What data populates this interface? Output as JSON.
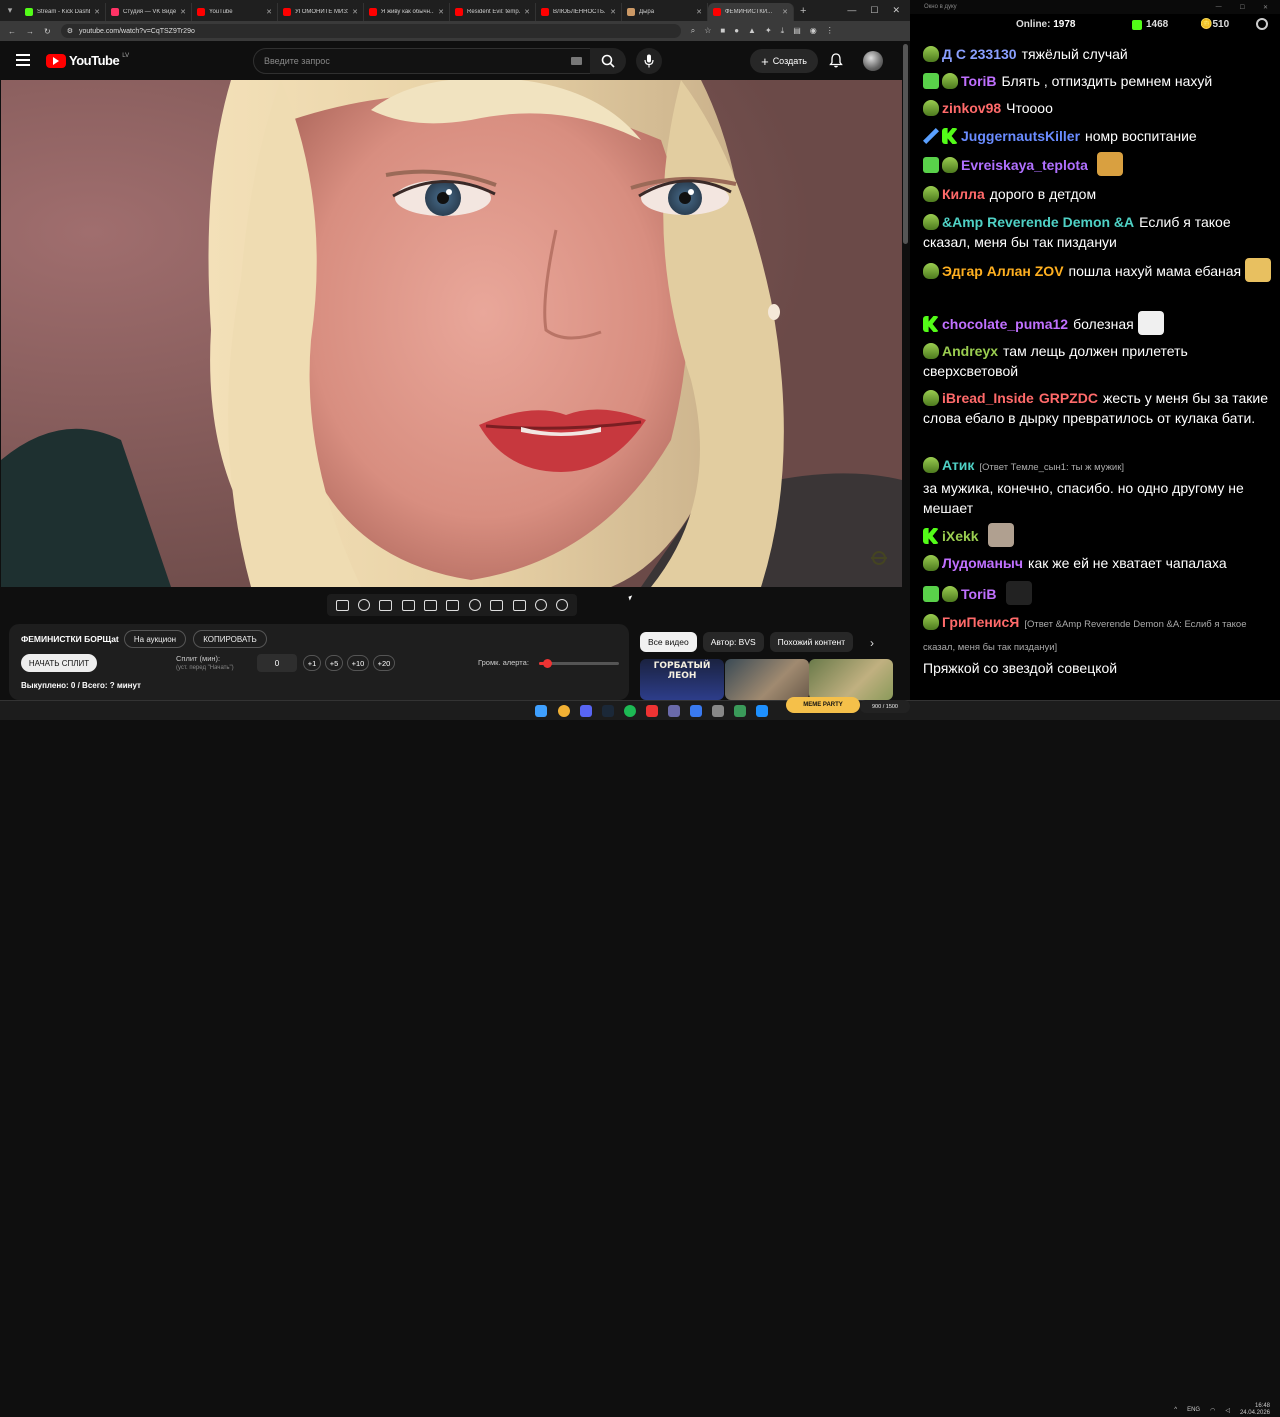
{
  "browser": {
    "tabs": [
      {
        "label": "Stream - Kick Dashb",
        "favicon_color": "#53fc18"
      },
      {
        "label": "Студия — VK Видео",
        "favicon_color": "#ff3366"
      },
      {
        "label": "YouTube",
        "favicon_color": "#ff0000"
      },
      {
        "label": "УГОМОНИТЕ МИЗУ...",
        "favicon_color": "#ff0000"
      },
      {
        "label": "Я живу как обычн...",
        "favicon_color": "#ff0000"
      },
      {
        "label": "Resident Evil: temp...",
        "favicon_color": "#ff0000"
      },
      {
        "label": "ВЛЮБЛЕННОСТЬ...",
        "favicon_color": "#ff0000"
      },
      {
        "label": "Дыра",
        "favicon_color": "#cc9966"
      },
      {
        "label": "ФЕМИНИСТКИ...",
        "favicon_color": "#ff0000"
      }
    ],
    "url": "youtube.com/watch?v=CqTSZ9Tr29o"
  },
  "youtube": {
    "logo_text": "YouTube",
    "country_code": "LV",
    "search_placeholder": "Введите запрос",
    "create_label": "Создать"
  },
  "player_panel": {
    "title": "ФЕМИНИСТКИ БОРЩat",
    "auction_label": "На аукцион",
    "copy_label": "КОПИРОВАТЬ",
    "start_split_label": "НАЧАТЬ СПЛИТ",
    "split_label": "Сплит (мин):",
    "split_hint": "(уст. перед \"Начать\")",
    "split_minutes": "0",
    "increments": [
      "+1",
      "+5",
      "+10",
      "+20"
    ],
    "alert_volume_label": "Громк. алерта:",
    "alert_volume": 0.1,
    "bought_text": "Выкуплено: 0 / Всего: ? минут"
  },
  "chips": [
    "Все видео",
    "Автор: BVS",
    "Похожий контент"
  ],
  "thumbnails": [
    {
      "text": "ГОРБАТЫЙ ЛЕОН"
    },
    {
      "text": ""
    },
    {
      "text": ""
    }
  ],
  "chat": {
    "window_title": "Окно в дуку",
    "online_label": "Online:",
    "online_count": "1978",
    "kick_count": "1468",
    "points_count": "510",
    "messages": [
      {
        "badges": [
          "sub"
        ],
        "user": "Д С 233130",
        "color": "#8aa0ff",
        "text": "тяжёлый случай"
      },
      {
        "badges": [
          "mod",
          "sub"
        ],
        "user": "ToriB",
        "color": "#c070ff",
        "text": "Блять , отпиздить ремнем нахуй"
      },
      {
        "badges": [
          "sub"
        ],
        "user": "zinkov98",
        "color": "#ff6a6a",
        "text": "Чтоооо"
      },
      {
        "badges": [
          "sword",
          "k"
        ],
        "user": "JuggernautsKiller",
        "color": "#6a8cff",
        "text": "номр воспитание"
      },
      {
        "badges": [
          "vip",
          "sub"
        ],
        "user": "Evreiskaya_teplota",
        "color": "#b070ff",
        "text": ""
      },
      {
        "badges": [
          "sub"
        ],
        "user": "Килла",
        "color": "#ff6a6a",
        "text": "дорого в детдом"
      },
      {
        "badges": [
          "sub"
        ],
        "user": "&Amp Reverende Demon &A",
        "color": "#4fd1c5",
        "text": "Еслиб я такое сказал, меня бы так пиздануи"
      },
      {
        "badges": [
          "sub"
        ],
        "user": "Эдгар Аллан ZOV",
        "color": "#ffb020",
        "text": "пошла нахуй мама ебаная"
      },
      {
        "badges": [
          "k"
        ],
        "user": "chocolate_puma12",
        "color": "#c070ff",
        "text": "болезная"
      },
      {
        "badges": [
          "sub"
        ],
        "user": "Andreyx",
        "color": "#9acd50",
        "text": "там лещь должен прилететь сверхсветовой"
      },
      {
        "badges": [
          "sub"
        ],
        "user": "iBread_Inside",
        "color": "#ff6a6a",
        "extra": "GRPZDC",
        "text": "жесть у меня бы за такие слова ебало в дырку превратилось от кулака бати."
      },
      {
        "badges": [
          "sub"
        ],
        "user": "Атик",
        "color": "#4fd1c5",
        "reply": "[Ответ Темле_сын1: ты ж мужик]",
        "text": "за мужика, конечно, спасибо. но одно другому не мешает"
      },
      {
        "badges": [
          "k"
        ],
        "user": "iXekk",
        "color": "#9acd50",
        "text": ""
      },
      {
        "badges": [
          "sub"
        ],
        "user": "Лудоманыч",
        "color": "#c070ff",
        "text": "как же ей не хватает чапалаха"
      },
      {
        "badges": [
          "mod",
          "sub"
        ],
        "user": "ToriB",
        "color": "#c070ff",
        "text": ""
      },
      {
        "badges": [
          "sub"
        ],
        "user": "ГриПенисЯ",
        "color": "#ff6a6a",
        "reply": "[Ответ &Amp Reverende Demon &A: Еслиб я такое сказал, меня бы так пиздануи]",
        "text": "Пряжкой со звездой совецкой"
      }
    ]
  },
  "taskbar": {
    "meme_party": "MEME PARTY",
    "progress_text": "900 / 1500",
    "lang": "ENG",
    "time": "16:48",
    "date": "24.04.2026"
  },
  "colors": {
    "kick_green": "#53fc18",
    "yt_red": "#ff0000",
    "page_bg": "#0f0f0f"
  }
}
